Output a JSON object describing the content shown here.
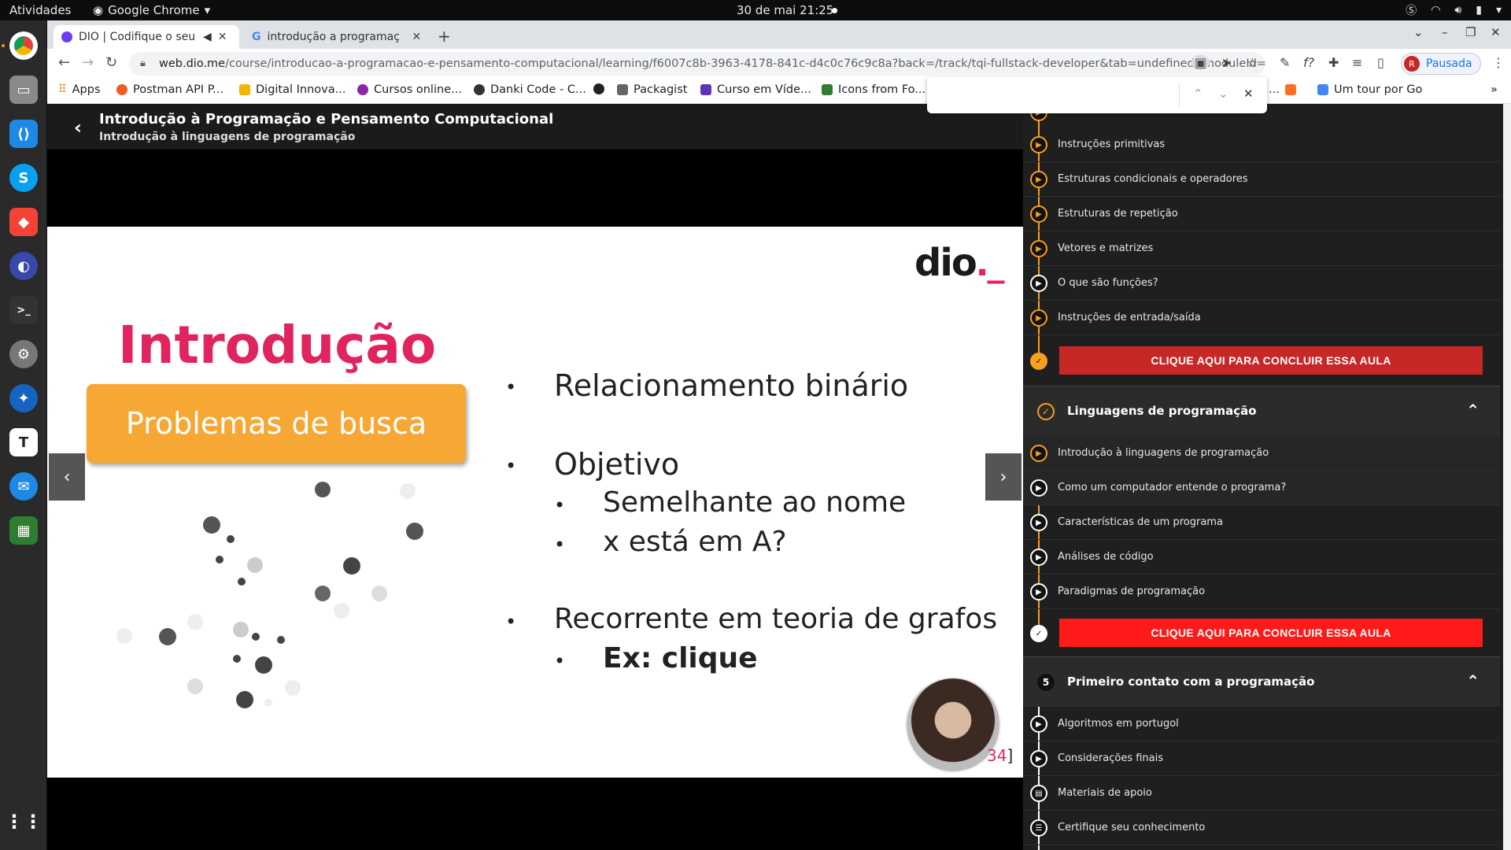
{
  "os": {
    "activities": "Atividades",
    "app_name": "Google Chrome",
    "clock": "30 de mai  21:25"
  },
  "browser": {
    "tabs": [
      {
        "title": "DIO | Codifique o seu f",
        "active": true
      },
      {
        "title": "introdução a programaç",
        "active": false
      }
    ],
    "url_host": "web.dio.me",
    "url_path": "/course/introducao-a-programacao-e-pensamento-computacional/learning/f6007c8b-3963-4178-841c-d4c0c76c9c8a?back=/track/tqi-fullstack-developer&tab=undefined&moduleId=undefined",
    "profile_initial": "R",
    "profile_label": "Pausada",
    "bookmarks": [
      {
        "label": "Apps",
        "color": "#e8710a"
      },
      {
        "label": "Postman API P...",
        "color": "#ef5b25"
      },
      {
        "label": "Digital Innova...",
        "color": "#f4b400"
      },
      {
        "label": "Cursos online...",
        "color": "#8e24aa"
      },
      {
        "label": "Danki Code - C...",
        "color": "#333333"
      },
      {
        "label": "",
        "color": "#222222"
      },
      {
        "label": "Packagist",
        "color": "#666666"
      },
      {
        "label": "Curso em Víde...",
        "color": "#5e35b1"
      },
      {
        "label": "Icons from Fo...",
        "color": "#2e7d32"
      },
      {
        "label": "...",
        "color": "#fc6d26"
      },
      {
        "label": "Um tour por Go",
        "color": "#4285f4"
      }
    ],
    "find_text": ""
  },
  "course": {
    "title": "Introdução à Programação e Pensamento Computacional",
    "lesson": "Introdução à linguagens de programação"
  },
  "slide": {
    "logo_text": "dio",
    "logo_suffix": "._",
    "title": "Introdução",
    "box": "Problemas de busca",
    "bullets": [
      {
        "level": 1,
        "text": "Relacionamento binário",
        "bold": false
      },
      {
        "level": 1,
        "text": "Objetivo",
        "bold": false
      },
      {
        "level": 2,
        "text": "Semelhante ao nome",
        "bold": false
      },
      {
        "level": 2,
        "text": "x está em A?",
        "bold": false
      },
      {
        "level": 1,
        "text": "Recorrente em teoria de grafos",
        "bold": false
      },
      {
        "level": 2,
        "text": "Ex: clique",
        "bold": true
      }
    ],
    "page_number": "34",
    "page_bracket": "]"
  },
  "sidebar": {
    "module1_lessons": [
      {
        "label": "Instruções primitivas",
        "icon": "play"
      },
      {
        "label": "Estruturas condicionais e operadores",
        "icon": "play"
      },
      {
        "label": "Estruturas de repetição",
        "icon": "play"
      },
      {
        "label": "Vetores e matrizes",
        "icon": "play"
      },
      {
        "label": "O que são funções?",
        "icon": "play-white"
      },
      {
        "label": "Instruções de entrada/saída",
        "icon": "play"
      }
    ],
    "module1_button": "CLIQUE AQUI PARA CONCLUIR ESSA AULA",
    "module2_title": "Linguagens de programação",
    "module2_lessons": [
      {
        "label": "Introdução à linguagens de programação",
        "icon": "play"
      },
      {
        "label": "Como um computador entende o programa?",
        "icon": "play-white"
      },
      {
        "label": "Características de um programa",
        "icon": "play-white"
      },
      {
        "label": "Análises de código",
        "icon": "play-white"
      },
      {
        "label": "Paradigmas de programação",
        "icon": "play-white"
      }
    ],
    "module2_button": "CLIQUE AQUI PARA CONCLUIR ESSA AULA",
    "module3_number": "5",
    "module3_title": "Primeiro contato com a programação",
    "module3_lessons": [
      {
        "label": "Algoritmos em portugol",
        "icon": "play-white"
      },
      {
        "label": "Considerações finais",
        "icon": "play-white"
      },
      {
        "label": "Materiais de apoio",
        "icon": "doc"
      },
      {
        "label": "Certifique seu conhecimento",
        "icon": "list"
      }
    ]
  },
  "colors": {
    "accent_orange": "#f7a01d",
    "conclude_dark": "#c62828",
    "conclude_bright": "#ff1a1a",
    "slide_title": "#e0245e",
    "slide_box": "#f7a733"
  }
}
